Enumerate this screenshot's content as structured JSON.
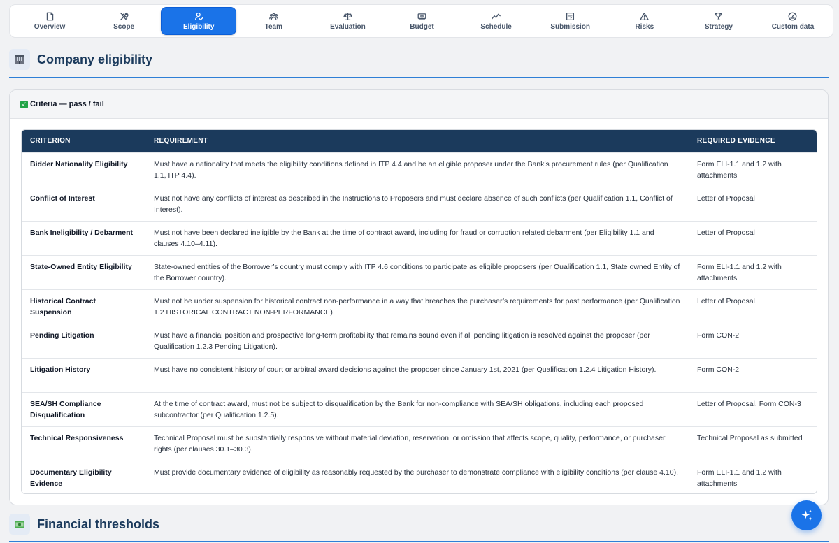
{
  "tabs": [
    {
      "label": "Overview",
      "icon": "document-icon"
    },
    {
      "label": "Scope",
      "icon": "tools-icon"
    },
    {
      "label": "Eligibility",
      "icon": "user-check-icon",
      "active": true
    },
    {
      "label": "Team",
      "icon": "team-icon"
    },
    {
      "label": "Evaluation",
      "icon": "scale-icon"
    },
    {
      "label": "Budget",
      "icon": "money-icon"
    },
    {
      "label": "Schedule",
      "icon": "trend-icon"
    },
    {
      "label": "Submission",
      "icon": "form-icon"
    },
    {
      "label": "Risks",
      "icon": "warning-icon"
    },
    {
      "label": "Strategy",
      "icon": "trophy-icon"
    },
    {
      "label": "Custom data",
      "icon": "gauge-icon"
    }
  ],
  "section": {
    "title": "Company eligibility",
    "icon": "building-icon"
  },
  "card": {
    "title": "Criteria — pass / fail",
    "icon": "check-icon"
  },
  "table": {
    "headers": {
      "criterion": "CRITERION",
      "requirement": "REQUIREMENT",
      "evidence": "REQUIRED EVIDENCE"
    },
    "rows": [
      {
        "criterion": "Bidder Nationality Eligibility",
        "requirement": "Must have a nationality that meets the eligibility conditions defined in ITP 4.4 and be an eligible proposer under the Bank’s procurement rules (per Qualification 1.1, ITP 4.4).",
        "evidence": "Form ELI-1.1 and 1.2 with attachments"
      },
      {
        "criterion": "Conflict of Interest",
        "requirement": "Must not have any conflicts of interest as described in the Instructions to Proposers and must declare absence of such conflicts (per Qualification 1.1, Conflict of Interest).",
        "evidence": "Letter of Proposal"
      },
      {
        "criterion": "Bank Ineligibility / Debarment",
        "requirement": "Must not have been declared ineligible by the Bank at the time of contract award, including for fraud or corruption related debarment (per Eligibility 1.1 and clauses 4.10–4.11).",
        "evidence": "Letter of Proposal"
      },
      {
        "criterion": "State-Owned Entity Eligibility",
        "requirement": "State-owned entities of the Borrower’s country must comply with ITP 4.6 conditions to participate as eligible proposers (per Qualification 1.1, State owned Entity of the Borrower country).",
        "evidence": "Form ELI-1.1 and 1.2 with attachments"
      },
      {
        "criterion": "Historical Contract Suspension",
        "requirement": "Must not be under suspension for historical contract non-performance in a way that breaches the purchaser’s requirements for past performance (per Qualification 1.2 HISTORICAL CONTRACT NON-PERFORMANCE).",
        "evidence": "Letter of Proposal"
      },
      {
        "criterion": "Pending Litigation",
        "requirement": "Must have a financial position and prospective long-term profitability that remains sound even if all pending litigation is resolved against the proposer (per Qualification 1.2.3 Pending Litigation).",
        "evidence": "Form CON-2"
      },
      {
        "criterion": "Litigation History",
        "requirement": "Must have no consistent history of court or arbitral award decisions against the proposer since January 1st, 2021 (per Qualification 1.2.4 Litigation History).",
        "evidence": "Form CON-2"
      },
      {
        "criterion": "SEA/SH Compliance Disqualification",
        "requirement": "At the time of contract award, must not be subject to disqualification by the Bank for non-compliance with SEA/SH obligations, including each proposed subcontractor (per Qualification 1.2.5).",
        "evidence": "Letter of Proposal, Form CON-3"
      },
      {
        "criterion": "Technical Responsiveness",
        "requirement": "Technical Proposal must be substantially responsive without material deviation, reservation, or omission that affects scope, quality, performance, or purchaser rights (per clauses 30.1–30.3).",
        "evidence": "Technical Proposal as submitted"
      },
      {
        "criterion": "Documentary Eligibility Evidence",
        "requirement": "Must provide documentary evidence of eligibility as reasonably requested by the purchaser to demonstrate compliance with eligibility conditions (per clause 4.10).",
        "evidence": "Form ELI-1.1 and 1.2 with attachments"
      }
    ]
  },
  "next_section": {
    "title": "Financial thresholds",
    "icon": "cash-icon"
  },
  "fab": {
    "icon": "sparkle-icon"
  },
  "colors": {
    "accent": "#1a73e8",
    "header_navy": "#1b3a5c",
    "rule_blue": "#2f7fd6"
  }
}
